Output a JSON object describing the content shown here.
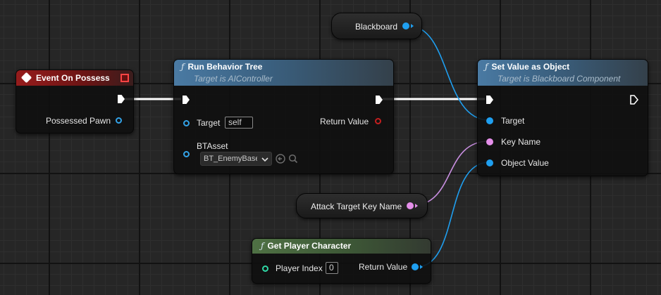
{
  "nodes": {
    "event_on_possess": {
      "title": "Event On Possess",
      "pins": {
        "possessed_pawn": "Possessed Pawn"
      }
    },
    "run_behavior_tree": {
      "title": "Run Behavior Tree",
      "subtitle": "Target is AIController",
      "pins": {
        "target": "Target",
        "target_default": "self",
        "return_value": "Return Value",
        "bt_asset": "BTAsset",
        "bt_asset_value": "BT_EnemyBase"
      }
    },
    "set_value_as_object": {
      "title": "Set Value as Object",
      "subtitle": "Target is Blackboard Component",
      "pins": {
        "target": "Target",
        "key_name": "Key Name",
        "object_value": "Object Value"
      }
    },
    "blackboard": {
      "label": "Blackboard"
    },
    "attack_target_key_name": {
      "label": "Attack Target Key Name"
    },
    "get_player_character": {
      "title": "Get Player Character",
      "pins": {
        "player_index": "Player Index",
        "player_index_value": "0",
        "return_value": "Return Value"
      }
    }
  },
  "icons": {
    "function": "ƒ",
    "event": "event-diamond-icon",
    "dropdown": "chevron-down-icon",
    "browse": "arrow-left-circle-icon",
    "search": "search-icon"
  },
  "colors": {
    "exec_wire": "#ffffff",
    "object_wire": "#1f9ff0",
    "name_wire": "#c88ee0",
    "event_header": "#961c1c",
    "function_header": "#4a7aa3",
    "pure_function_header": "#4f7144"
  }
}
